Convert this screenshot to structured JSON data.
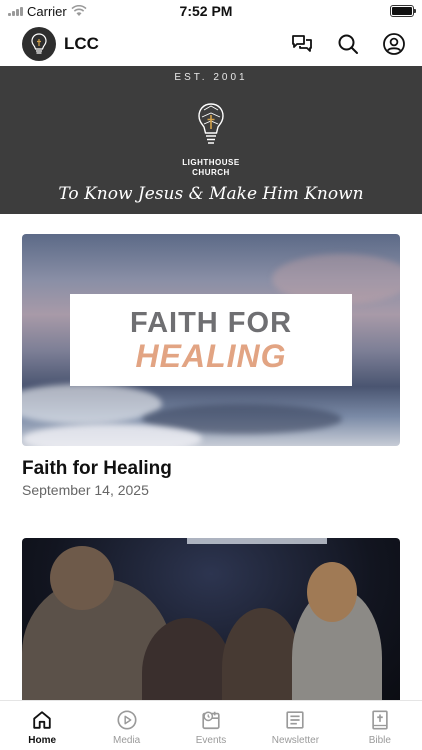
{
  "status_bar": {
    "carrier": "Carrier",
    "time": "7:52 PM"
  },
  "header": {
    "title": "LCC"
  },
  "banner": {
    "est": "EST. 2001",
    "church_name_line1": "LIGHTHOUSE",
    "church_name_line2": "CHURCH",
    "tagline": "To Know Jesus & Make Him Known"
  },
  "feed": [
    {
      "image_title_line1": "FAITH FOR",
      "image_title_line2": "HEALING",
      "title": "Faith for Healing",
      "date": "September 14, 2025"
    }
  ],
  "tabs": [
    {
      "label": "Home",
      "icon": "home-icon",
      "active": true
    },
    {
      "label": "Media",
      "icon": "play-icon",
      "active": false
    },
    {
      "label": "Events",
      "icon": "events-icon",
      "active": false
    },
    {
      "label": "Newsletter",
      "icon": "newsletter-icon",
      "active": false
    },
    {
      "label": "Bible",
      "icon": "bible-icon",
      "active": false
    }
  ],
  "colors": {
    "banner_bg": "#3d3d3d",
    "accent_healing": "#e2a483",
    "inactive_tab": "#9a9a9a",
    "active_tab": "#111111"
  }
}
